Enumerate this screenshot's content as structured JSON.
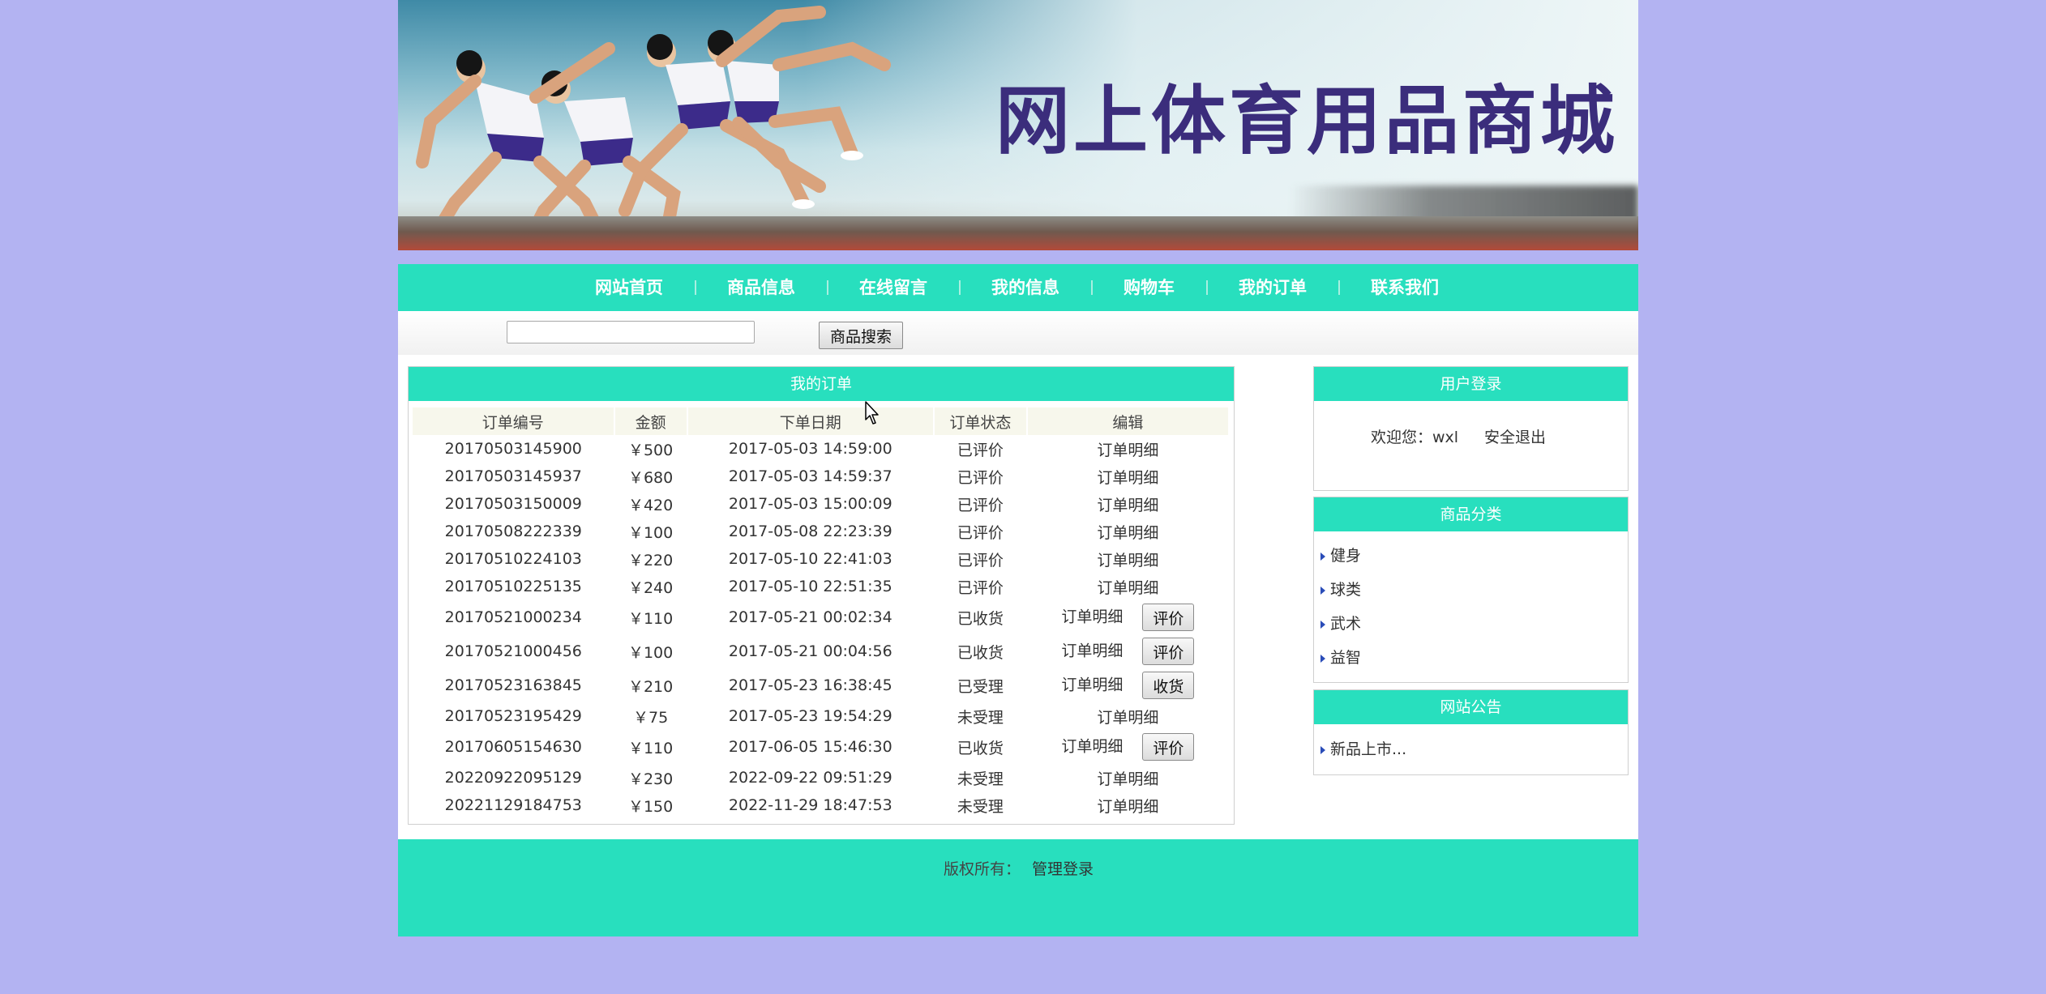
{
  "banner": {
    "title": "网上体育用品商城"
  },
  "nav": {
    "items": [
      {
        "label": "网站首页"
      },
      {
        "label": "商品信息"
      },
      {
        "label": "在线留言"
      },
      {
        "label": "我的信息"
      },
      {
        "label": "购物车"
      },
      {
        "label": "我的订单"
      },
      {
        "label": "联系我们"
      }
    ]
  },
  "search": {
    "value": "",
    "button_label": "商品搜索"
  },
  "orders": {
    "title": "我的订单",
    "columns": [
      "订单编号",
      "金额",
      "下单日期",
      "订单状态",
      "编辑"
    ],
    "rows": [
      {
        "no": "20170503145900",
        "amount": "￥500",
        "date": "2017-05-03 14:59:00",
        "status": "已评价",
        "detail": "订单明细",
        "action": ""
      },
      {
        "no": "20170503145937",
        "amount": "￥680",
        "date": "2017-05-03 14:59:37",
        "status": "已评价",
        "detail": "订单明细",
        "action": ""
      },
      {
        "no": "20170503150009",
        "amount": "￥420",
        "date": "2017-05-03 15:00:09",
        "status": "已评价",
        "detail": "订单明细",
        "action": ""
      },
      {
        "no": "20170508222339",
        "amount": "￥100",
        "date": "2017-05-08 22:23:39",
        "status": "已评价",
        "detail": "订单明细",
        "action": ""
      },
      {
        "no": "20170510224103",
        "amount": "￥220",
        "date": "2017-05-10 22:41:03",
        "status": "已评价",
        "detail": "订单明细",
        "action": ""
      },
      {
        "no": "20170510225135",
        "amount": "￥240",
        "date": "2017-05-10 22:51:35",
        "status": "已评价",
        "detail": "订单明细",
        "action": ""
      },
      {
        "no": "20170521000234",
        "amount": "￥110",
        "date": "2017-05-21 00:02:34",
        "status": "已收货",
        "detail": "订单明细",
        "action": "评价"
      },
      {
        "no": "20170521000456",
        "amount": "￥100",
        "date": "2017-05-21 00:04:56",
        "status": "已收货",
        "detail": "订单明细",
        "action": "评价"
      },
      {
        "no": "20170523163845",
        "amount": "￥210",
        "date": "2017-05-23 16:38:45",
        "status": "已受理",
        "detail": "订单明细",
        "action": "收货"
      },
      {
        "no": "20170523195429",
        "amount": "￥75",
        "date": "2017-05-23 19:54:29",
        "status": "未受理",
        "detail": "订单明细",
        "action": ""
      },
      {
        "no": "20170605154630",
        "amount": "￥110",
        "date": "2017-06-05 15:46:30",
        "status": "已收货",
        "detail": "订单明细",
        "action": "评价"
      },
      {
        "no": "20220922095129",
        "amount": "￥230",
        "date": "2022-09-22 09:51:29",
        "status": "未受理",
        "detail": "订单明细",
        "action": ""
      },
      {
        "no": "20221129184753",
        "amount": "￥150",
        "date": "2022-11-29 18:47:53",
        "status": "未受理",
        "detail": "订单明细",
        "action": ""
      }
    ]
  },
  "login": {
    "title": "用户登录",
    "welcome": "欢迎您：wxl",
    "logout": "安全退出"
  },
  "categories": {
    "title": "商品分类",
    "items": [
      "健身",
      "球类",
      "武术",
      "益智"
    ]
  },
  "notice": {
    "title": "网站公告",
    "items": [
      "新品上市..."
    ]
  },
  "footer": {
    "copyright": "版权所有：",
    "admin_login": "管理登录"
  },
  "colors": {
    "background": "#b3b3f2",
    "accent": "#28dfbe",
    "banner_title": "#3b2d7c"
  }
}
